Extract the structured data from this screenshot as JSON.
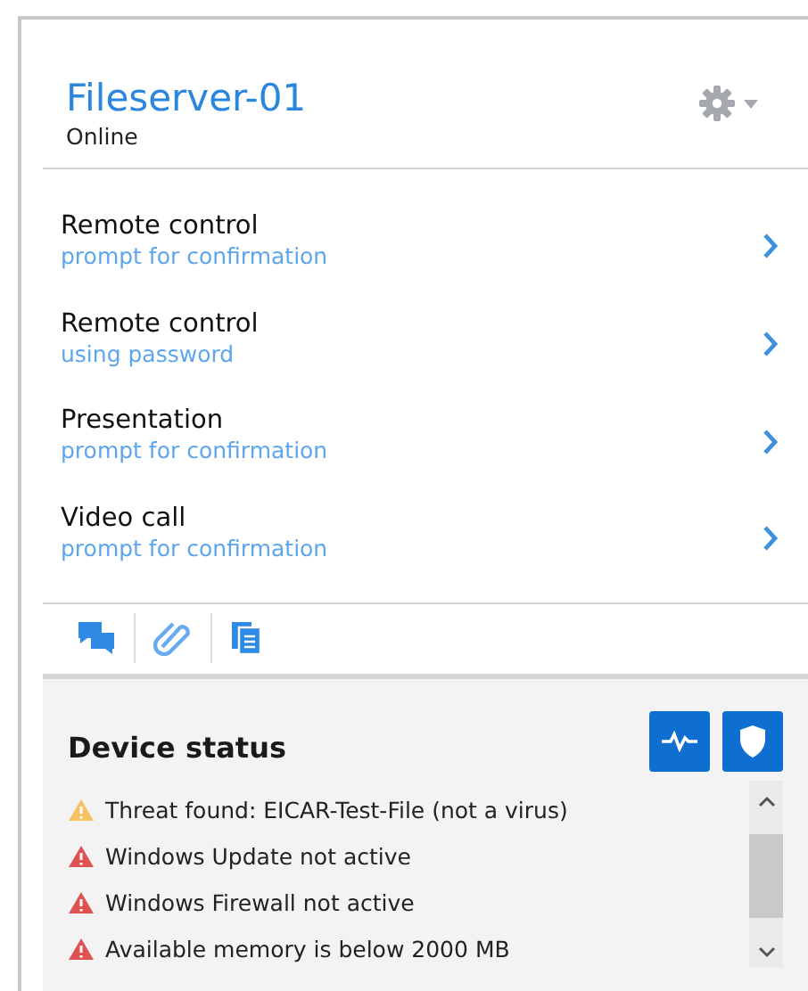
{
  "device": {
    "name": "Fileserver-01",
    "status": "Online"
  },
  "actions": [
    {
      "title": "Remote control",
      "subtitle": "prompt for confirmation"
    },
    {
      "title": "Remote control",
      "subtitle": "using password"
    },
    {
      "title": "Presentation",
      "subtitle": "prompt for confirmation"
    },
    {
      "title": "Video call",
      "subtitle": "prompt for confirmation"
    }
  ],
  "toolbar": [
    {
      "kind": "chat"
    },
    {
      "kind": "attachment"
    },
    {
      "kind": "notes"
    }
  ],
  "device_status": {
    "title": "Device status",
    "alerts": [
      {
        "text": "Threat found: EICAR-Test-File (not a virus)",
        "color": "#f7c063"
      },
      {
        "text": "Windows Update not active",
        "color": "#e05252"
      },
      {
        "text": "Windows Firewall not active",
        "color": "#e05252"
      },
      {
        "text": "Available memory is below 2000 MB",
        "color": "#e05252"
      }
    ]
  }
}
